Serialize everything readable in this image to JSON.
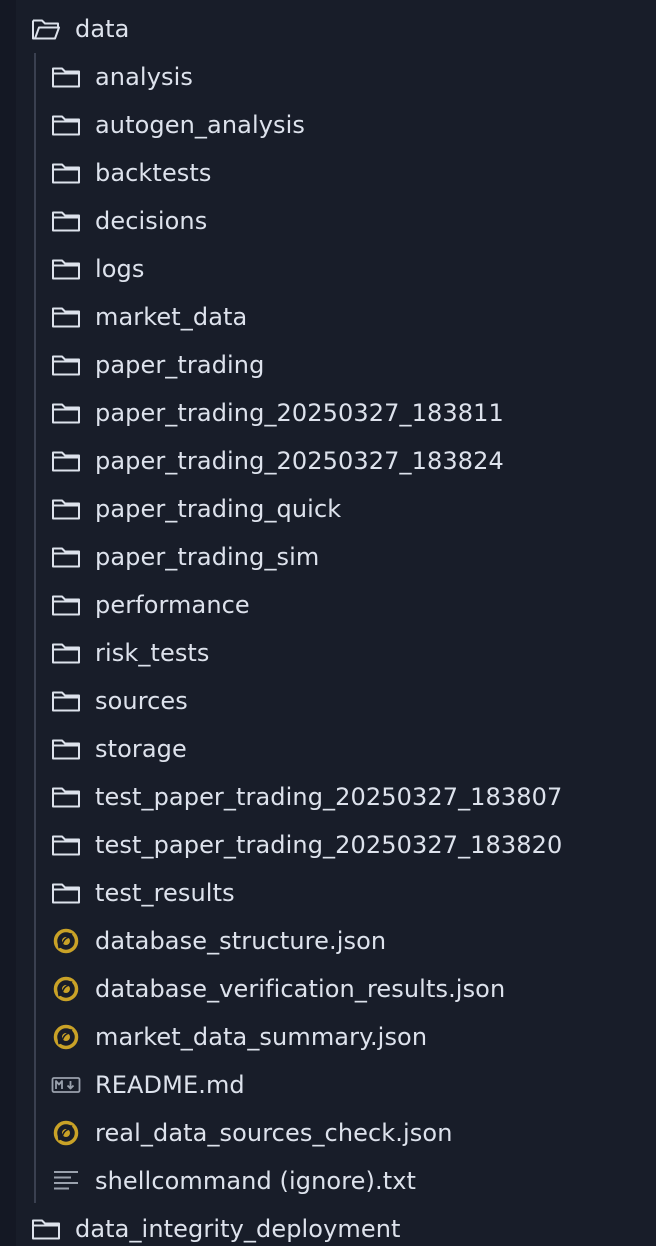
{
  "root_folder": {
    "label": "data",
    "icon": "folder-open-icon"
  },
  "children": [
    {
      "label": "analysis",
      "icon": "folder-icon",
      "kind": "folder"
    },
    {
      "label": "autogen_analysis",
      "icon": "folder-icon",
      "kind": "folder"
    },
    {
      "label": "backtests",
      "icon": "folder-icon",
      "kind": "folder"
    },
    {
      "label": "decisions",
      "icon": "folder-icon",
      "kind": "folder"
    },
    {
      "label": "logs",
      "icon": "folder-icon",
      "kind": "folder"
    },
    {
      "label": "market_data",
      "icon": "folder-icon",
      "kind": "folder"
    },
    {
      "label": "paper_trading",
      "icon": "folder-icon",
      "kind": "folder"
    },
    {
      "label": "paper_trading_20250327_183811",
      "icon": "folder-icon",
      "kind": "folder"
    },
    {
      "label": "paper_trading_20250327_183824",
      "icon": "folder-icon",
      "kind": "folder"
    },
    {
      "label": "paper_trading_quick",
      "icon": "folder-icon",
      "kind": "folder"
    },
    {
      "label": "paper_trading_sim",
      "icon": "folder-icon",
      "kind": "folder"
    },
    {
      "label": "performance",
      "icon": "folder-icon",
      "kind": "folder"
    },
    {
      "label": "risk_tests",
      "icon": "folder-icon",
      "kind": "folder"
    },
    {
      "label": "sources",
      "icon": "folder-icon",
      "kind": "folder"
    },
    {
      "label": "storage",
      "icon": "folder-icon",
      "kind": "folder"
    },
    {
      "label": "test_paper_trading_20250327_183807",
      "icon": "folder-icon",
      "kind": "folder"
    },
    {
      "label": "test_paper_trading_20250327_183820",
      "icon": "folder-icon",
      "kind": "folder"
    },
    {
      "label": "test_results",
      "icon": "folder-icon",
      "kind": "folder"
    },
    {
      "label": "database_structure.json",
      "icon": "json-file-icon",
      "kind": "json"
    },
    {
      "label": "database_verification_results.json",
      "icon": "json-file-icon",
      "kind": "json"
    },
    {
      "label": "market_data_summary.json",
      "icon": "json-file-icon",
      "kind": "json"
    },
    {
      "label": "README.md",
      "icon": "markdown-file-icon",
      "kind": "markdown"
    },
    {
      "label": "real_data_sources_check.json",
      "icon": "json-file-icon",
      "kind": "json"
    },
    {
      "label": "shellcommand (ignore).txt",
      "icon": "text-file-icon",
      "kind": "text"
    }
  ],
  "sibling_folder": {
    "label": "data_integrity_deployment",
    "icon": "folder-icon"
  },
  "colors": {
    "background": "#181d29",
    "text": "#dde2ec",
    "icon_stroke": "#dde2ec",
    "json_icon": "#c9a227",
    "indent_guide": "#3a4050"
  }
}
